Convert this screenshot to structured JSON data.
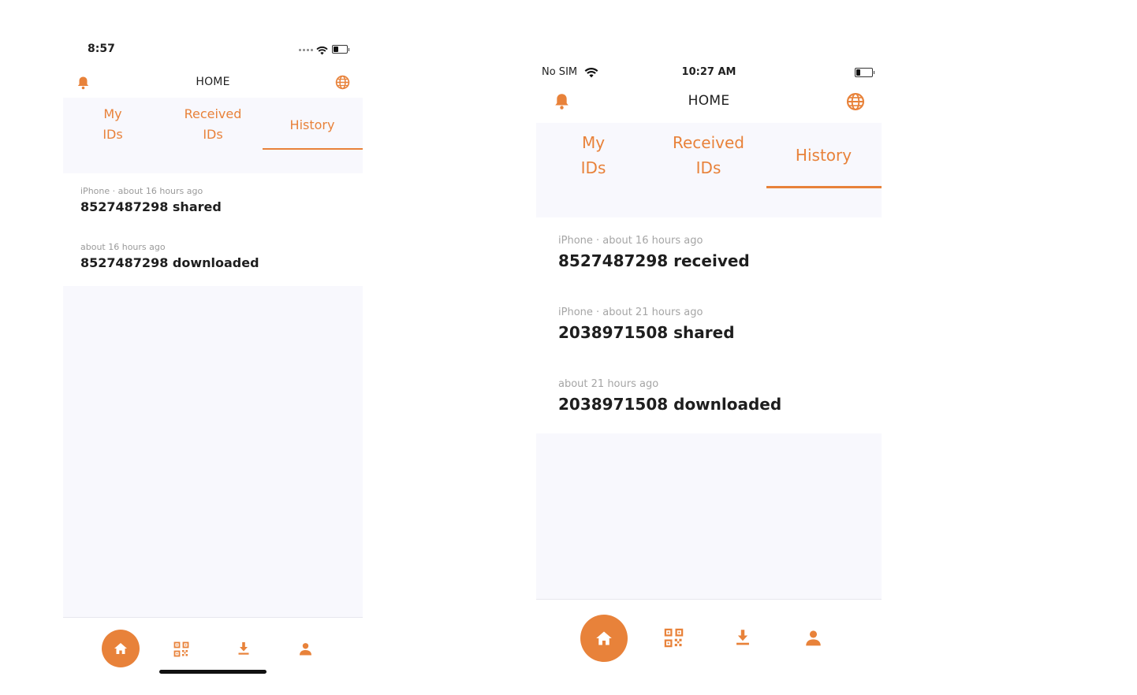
{
  "colors": {
    "accent": "#e8823a",
    "panel": "#f8f8fd",
    "text": "#1e1e1e",
    "meta": "#9a9a9a"
  },
  "phone_a": {
    "status": {
      "time": "8:57"
    },
    "header": {
      "title": "HOME",
      "left_icon": "bell-icon",
      "right_icon": "globe-icon"
    },
    "tabs": [
      {
        "line1": "My",
        "line2": "IDs"
      },
      {
        "line1": "Received",
        "line2": "IDs"
      },
      {
        "label": "History",
        "active": true
      }
    ],
    "history": [
      {
        "meta": "iPhone · about 16 hours ago",
        "text": "8527487298 shared"
      },
      {
        "meta": "about 16 hours ago",
        "text": "8527487298 downloaded"
      }
    ],
    "nav": [
      "home-icon",
      "qr-code-icon",
      "download-icon",
      "user-icon"
    ]
  },
  "phone_b": {
    "status": {
      "carrier": "No SIM",
      "time": "10:27 AM"
    },
    "header": {
      "title": "HOME",
      "left_icon": "bell-icon",
      "right_icon": "globe-icon"
    },
    "tabs": [
      {
        "line1": "My",
        "line2": "IDs"
      },
      {
        "line1": "Received",
        "line2": "IDs"
      },
      {
        "label": "History",
        "active": true
      }
    ],
    "history": [
      {
        "meta": "iPhone · about 16 hours ago",
        "text": "8527487298 received"
      },
      {
        "meta": "iPhone · about 21 hours ago",
        "text": "2038971508 shared"
      },
      {
        "meta": "about 21 hours ago",
        "text": "2038971508 downloaded"
      }
    ],
    "nav": [
      "home-icon",
      "qr-code-icon",
      "download-icon",
      "user-icon"
    ]
  }
}
